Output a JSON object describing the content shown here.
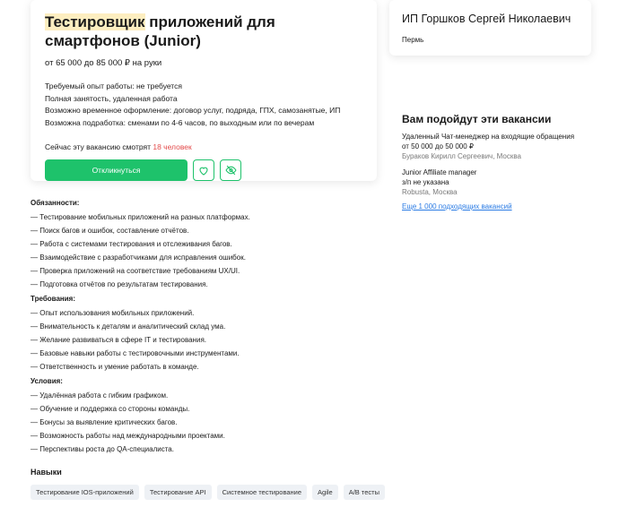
{
  "vacancy": {
    "title_highlight": "Тестировщик",
    "title_rest": " приложений для смартфонов (Junior)",
    "salary": "от 65 000 до 85 000 ₽ на руки",
    "conditions": [
      "Требуемый опыт работы: не требуется",
      "Полная занятость, удаленная работа",
      "Возможно временное оформление: договор услуг, подряда, ГПХ, самозанятые, ИП",
      "Возможна подработка: сменами по 4-6 часов, по выходным или по вечерам"
    ],
    "viewers_prefix": "Сейчас эту вакансию смотрят ",
    "viewers_count": "18 человек",
    "respond_label": "Откликнуться",
    "favorite_icon": "heart-icon",
    "hide_icon": "eye-off-icon",
    "accent_color": "#1ec26b"
  },
  "employer": {
    "name": "ИП Горшков Сергей Николаевич",
    "city": "Пермь"
  },
  "similar": {
    "title": "Вам подойдут эти вакансии",
    "items": [
      {
        "title": "Удаленный Чат-менеджер на входящие обращения",
        "salary": "от 50 000 до 50 000 ₽",
        "meta": "Бураков Кирилл Сергеевич, Москва"
      },
      {
        "title": "Junior Affiliate manager",
        "salary": "з/п не указана",
        "meta": "Robusta, Москва"
      }
    ],
    "more_link": "Еще 1 000 подходящих вакансий"
  },
  "description": {
    "duties_title": "Обязанности:",
    "duties": [
      "— Тестирование мобильных приложений на разных платформах.",
      "— Поиск багов и ошибок, составление отчётов.",
      "— Работа с системами тестирования и отслеживания багов.",
      "— Взаимодействие с разработчиками для исправления ошибок.",
      "— Проверка приложений на соответствие требованиям UX/UI.",
      "— Подготовка отчётов по результатам тестирования."
    ],
    "requirements_title": "Требования:",
    "requirements": [
      "— Опыт использования мобильных приложений.",
      "— Внимательность к деталям и аналитический склад ума.",
      "— Желание развиваться в сфере IT и тестирования.",
      "— Базовые навыки работы с тестировочными инструментами.",
      "— Ответственность и умение работать в команде."
    ],
    "terms_title": "Условия:",
    "terms": [
      "— Удалённая работа с гибким графиком.",
      "— Обучение и поддержка со стороны команды.",
      "— Бонусы за выявление критических багов.",
      "— Возможность работы над международными проектами.",
      "— Перспективы роста до QA-специалиста."
    ]
  },
  "skills": {
    "title": "Навыки",
    "tags": [
      "Тестирование IOS-приложений",
      "Тестирование API",
      "Системное тестирование",
      "Agile",
      "A/B тесты"
    ]
  }
}
